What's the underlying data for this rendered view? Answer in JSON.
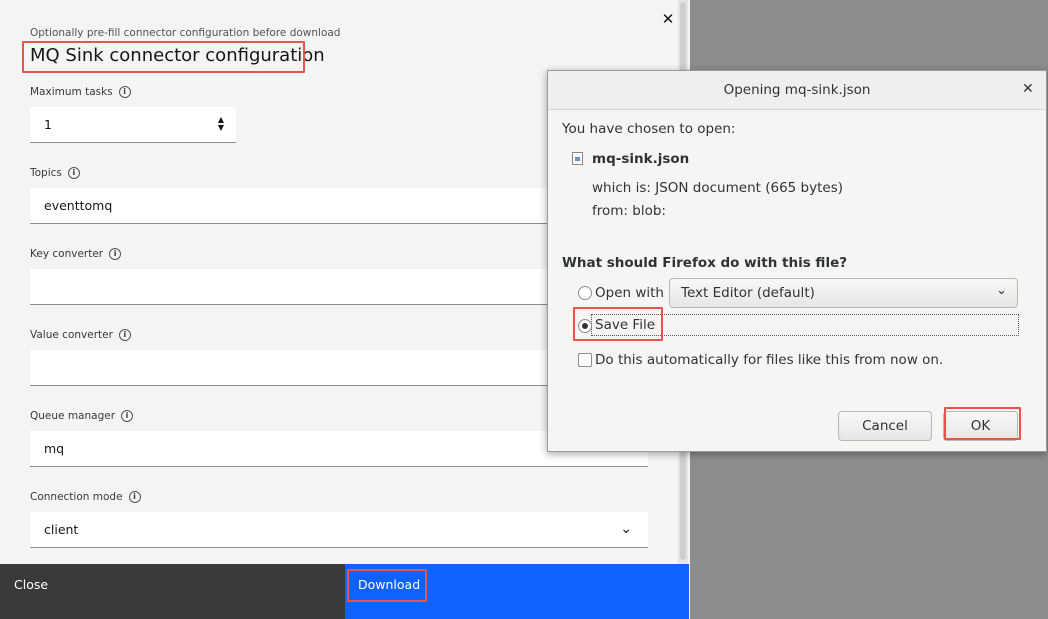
{
  "panel": {
    "subtitle": "Optionally pre-fill connector configuration before download",
    "title": "MQ Sink connector configuration",
    "close_glyph": "✕",
    "info_glyph": "i",
    "fields": {
      "max_tasks": {
        "label": "Maximum tasks",
        "value": "1"
      },
      "topics": {
        "label": "Topics",
        "value": "eventtomq"
      },
      "key_converter": {
        "label": "Key converter",
        "value": ""
      },
      "value_converter": {
        "label": "Value converter",
        "value": ""
      },
      "queue_manager": {
        "label": "Queue manager",
        "value": "mq"
      },
      "connection_mode": {
        "label": "Connection mode",
        "value": "client"
      }
    },
    "footer": {
      "close_label": "Close",
      "download_label": "Download"
    }
  },
  "dialog": {
    "title": "Opening mq-sink.json",
    "close_glyph": "✕",
    "chosen_text": "You have chosen to open:",
    "file_name": "mq-sink.json",
    "which_is": "which is: JSON document (665 bytes)",
    "from": "from: blob:",
    "question": "What should Firefox do with this file?",
    "open_with_label": "Open with",
    "open_with_app": "Text Editor (default)",
    "save_file_label": "Save File",
    "auto_label": "Do this automatically for files like this from now on.",
    "cancel_label": "Cancel",
    "ok_label": "OK",
    "selected_option": "Save File",
    "auto_checked": false
  },
  "colors": {
    "highlight": "#e8534a",
    "primary_button": "#0f62fe",
    "secondary_button": "#393939"
  }
}
